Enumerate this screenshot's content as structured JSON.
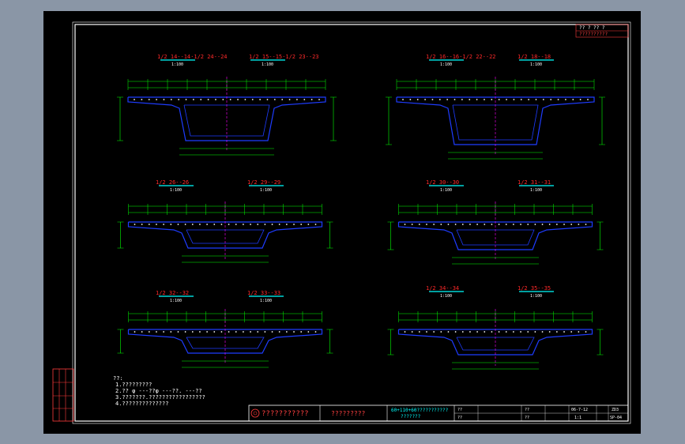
{
  "colors": {
    "background": "#000000",
    "desktop": "#8a96a6",
    "frame": "#ffffff",
    "concrete": "#1e3cff",
    "dimension": "#00ff00",
    "section_title": "#ff2a2a",
    "scale": "#00ffff",
    "centerline": "#ff00ff",
    "rebar": "#ffffff"
  },
  "sections": [
    {
      "id": "s1",
      "label": "1/2 14--14·1/2 24--24",
      "label2": "1/2 15--15·1/2 23--23",
      "scale": "1:100",
      "size": "large"
    },
    {
      "id": "s2",
      "label": "1/2 16--16·1/2 22--22",
      "label2": "1/2 18--18",
      "scale": "1:100",
      "size": "large"
    },
    {
      "id": "s3",
      "label": "1/2 26--26",
      "label2": "1/2 29--29",
      "scale": "1:100",
      "size": "medium"
    },
    {
      "id": "s4",
      "label": "1/2 30--30",
      "label2": "1/2 31--31",
      "scale": "1:100",
      "size": "medium"
    },
    {
      "id": "s5",
      "label": "1/2 32--32",
      "label2": "1/2 33--33",
      "scale": "1:100",
      "size": "medium"
    },
    {
      "id": "s6",
      "label": "1/2 34--34",
      "label2": "1/2 35--35",
      "scale": "1:100",
      "size": "medium"
    }
  ],
  "notes": {
    "heading": "??:",
    "lines": [
      "1.?????????",
      "2.?? φ ---??φ    ---??.    ---??",
      "3.???????.?????????????????",
      "4.??????????????"
    ]
  },
  "title_block": {
    "company": "???????????",
    "project": "?????????",
    "drawing_title": "60+110+60???????????",
    "drawing_subtitle": "???????",
    "design": "??",
    "check": "??",
    "review": "??",
    "approve": "??",
    "date": "06-7-12",
    "scale_label": "1:1",
    "sheet": "SP-04",
    "code": "ZD3"
  },
  "corner_tag": {
    "row1": "?? ?  ?? ?",
    "row2": "??????????"
  }
}
